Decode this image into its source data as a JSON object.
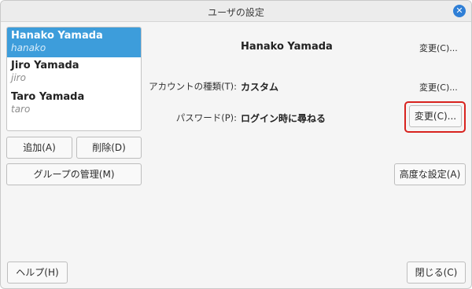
{
  "window": {
    "title": "ユーザの設定"
  },
  "users": [
    {
      "name": "Hanako Yamada",
      "login": "hanako",
      "selected": true
    },
    {
      "name": "Jiro Yamada",
      "login": "jiro",
      "selected": false
    },
    {
      "name": "Taro Yamada",
      "login": "taro",
      "selected": false
    }
  ],
  "left_buttons": {
    "add": "追加(A)",
    "delete": "削除(D)",
    "manage_groups": "グループの管理(M)",
    "help": "ヘルプ(H)"
  },
  "details": {
    "full_name": "Hanako Yamada",
    "full_name_change": "変更(C)...",
    "account_type_label": "アカウントの種類(T):",
    "account_type_value": "カスタム",
    "account_type_change": "変更(C)...",
    "password_label": "パスワード(P):",
    "password_value": "ログイン時に尋ねる",
    "password_change": "変更(C)..."
  },
  "right_buttons": {
    "advanced": "高度な設定(A)",
    "close": "閉じる(C)"
  },
  "colors": {
    "selection": "#3d9ddb",
    "highlight": "#d8231f",
    "close_icon": "#2f7fd6"
  }
}
